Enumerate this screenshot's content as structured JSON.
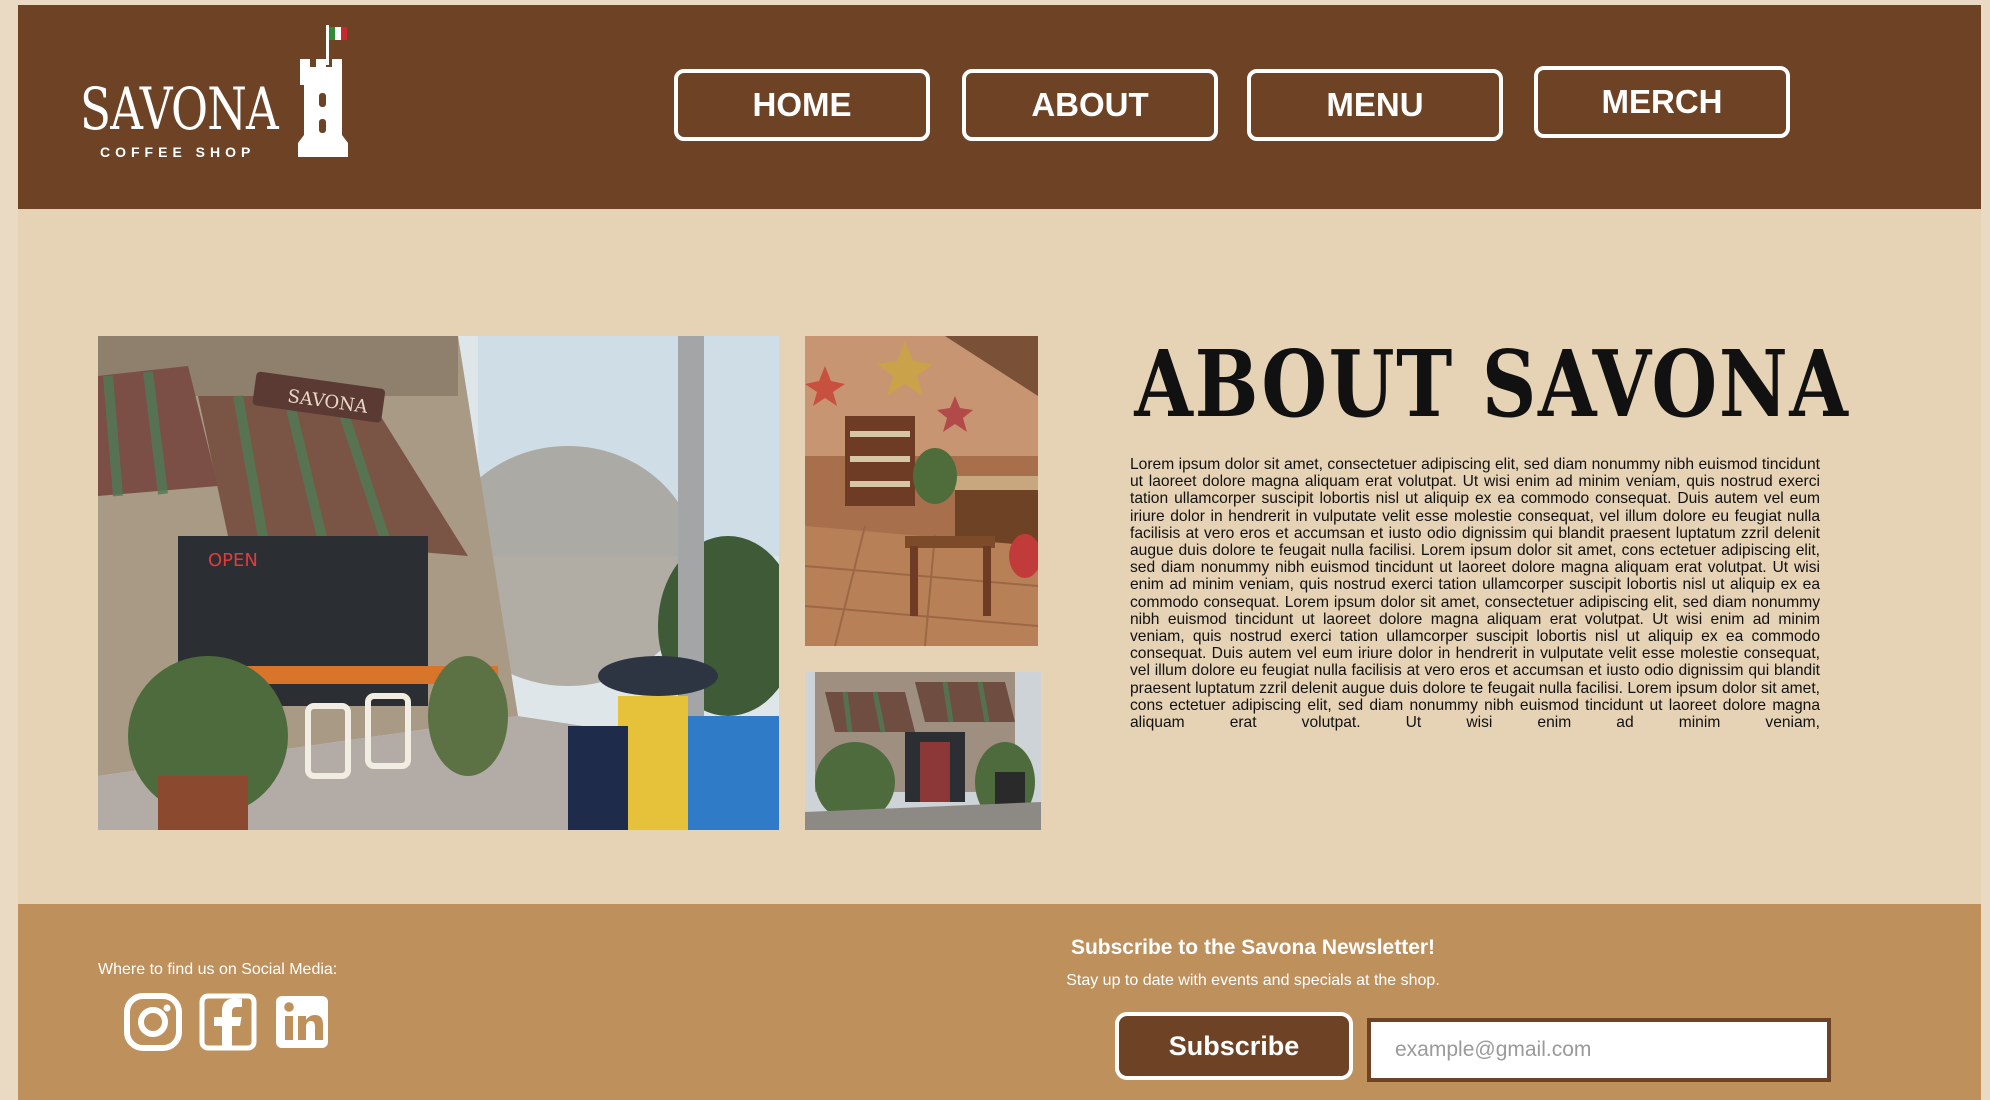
{
  "header": {
    "logo": {
      "name": "SAVONA",
      "tagline": "COFFEE SHOP"
    },
    "nav": [
      {
        "label": "HOME"
      },
      {
        "label": "ABOUT"
      },
      {
        "label": "MENU"
      },
      {
        "label": "MERCH"
      }
    ]
  },
  "main": {
    "title": "ABOUT SAVONA",
    "body": "Lorem ipsum dolor sit amet, consectetuer adipiscing elit, sed diam nonummy nibh euismod tincidunt ut laoreet dolore magna aliquam erat volutpat. Ut wisi enim ad minim veniam, quis nostrud exerci tation ullamcorper suscipit lobortis nisl ut aliquip ex ea commodo consequat. Duis autem vel eum iriure dolor in hendrerit in vulputate velit esse molestie consequat, vel illum dolore eu feugiat nulla facilisis at vero eros et accumsan et iusto odio dignissim qui blandit praesent luptatum zzril delenit augue duis dolore te feugait nulla facilisi. Lorem ipsum dolor sit amet, cons ectetuer adipiscing elit, sed diam nonummy nibh euismod tincidunt ut laoreet dolore magna aliquam erat volutpat. Ut wisi enim ad minim veniam, quis nostrud exerci tation ullamcorper suscipit lobortis nisl ut aliquip ex ea commodo consequat. Lorem ipsum dolor sit amet, consectetuer adipiscing elit, sed diam nonummy nibh euismod tincidunt ut laoreet dolore magna aliquam erat volutpat. Ut wisi enim ad minim veniam, quis nostrud exerci tation ullamcorper suscipit lobortis nisl ut aliquip ex ea commodo consequat. Duis autem vel eum iriure dolor in hendrerit in vulputate velit esse molestie consequat, vel illum dolore eu feugiat nulla facilisis at vero eros et accumsan et iusto odio dignissim qui blandit praesent luptatum zzril delenit augue duis dolore te feugait nulla facilisi. Lorem ipsum dolor sit amet, cons ectetuer adipiscing elit, sed diam nonummy nibh euismod tincidunt ut laoreet dolore magna aliquam erat volutpat. Ut wisi enim ad minim veniam,",
    "photos": {
      "storefront_sign": "SAVONA",
      "open_sign": "OPEN"
    }
  },
  "footer": {
    "social_label": "Where to find us on Social Media:",
    "social_icons": [
      "instagram-icon",
      "facebook-icon",
      "linkedin-icon"
    ],
    "newsletter": {
      "title": "Subscribe to the Savona Newsletter!",
      "subtitle": "Stay up to date with events and specials at the shop.",
      "button_label": "Subscribe",
      "email_placeholder": "example@gmail.com",
      "email_value": ""
    }
  },
  "colors": {
    "header_brown": "#6e4325",
    "page_beige": "#e6d2b5",
    "footer_tan": "#be905c",
    "white": "#ffffff"
  }
}
